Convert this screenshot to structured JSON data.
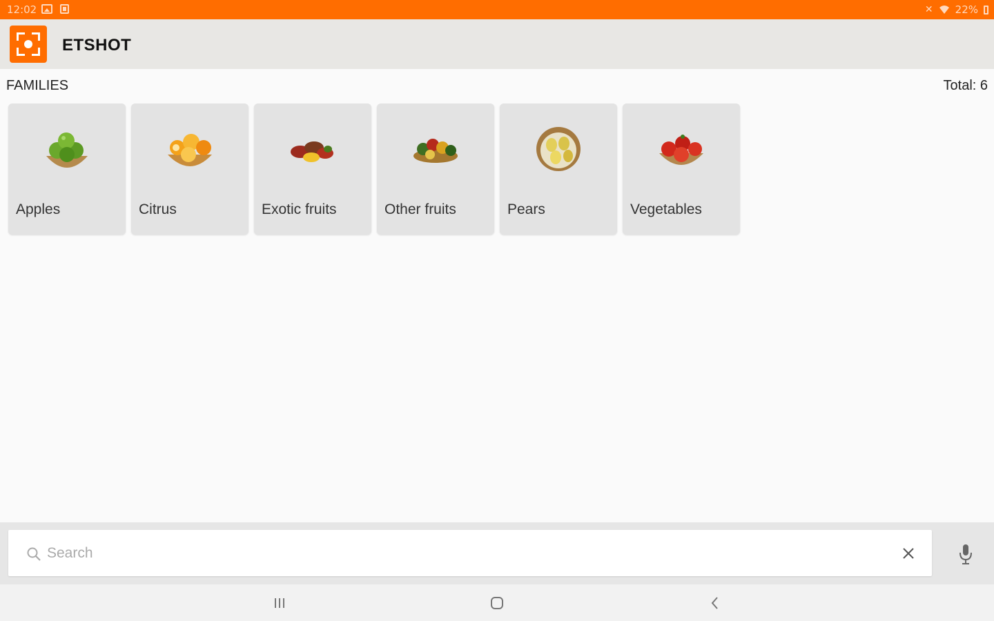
{
  "status_bar": {
    "time": "12:02",
    "battery": "22%"
  },
  "app_bar": {
    "title": "ETSHOT",
    "logo_icon": "camera-focus-icon",
    "accent_color": "#ff6d00"
  },
  "families": {
    "heading": "FAMILIES",
    "total_label": "Total: 6",
    "items": [
      {
        "label": "Apples",
        "icon": "apples-basket-image"
      },
      {
        "label": "Citrus",
        "icon": "citrus-basket-image"
      },
      {
        "label": "Exotic fruits",
        "icon": "exotic-fruits-image"
      },
      {
        "label": "Other fruits",
        "icon": "other-fruits-image"
      },
      {
        "label": "Pears",
        "icon": "pears-basket-image"
      },
      {
        "label": "Vegetables",
        "icon": "tomatoes-basket-image"
      }
    ]
  },
  "search": {
    "placeholder": "Search",
    "value": ""
  },
  "nav": {
    "recents_icon": "recents-icon",
    "home_icon": "home-icon",
    "back_icon": "back-icon"
  }
}
